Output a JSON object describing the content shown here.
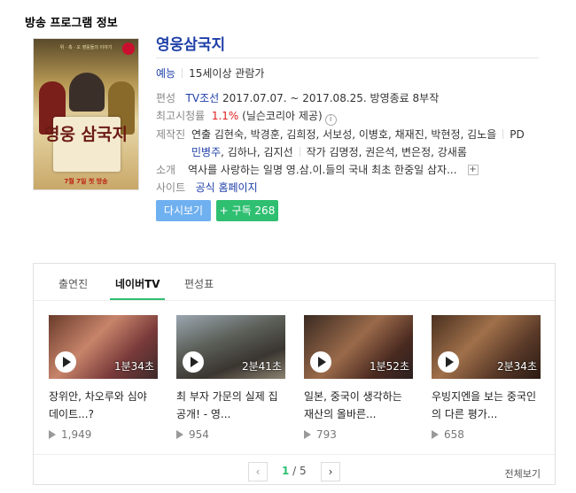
{
  "section_title": "방송 프로그램 정보",
  "poster": {
    "title": "영웅 삼국지",
    "tagline": "7월 7일 첫 방송",
    "top_text": "위 · 촉 · 오 영웅들의 이야기"
  },
  "program": {
    "title": "영웅삼국지",
    "genre": "예능",
    "rating": "15세이상 관람가",
    "schedule_label": "편성",
    "channel": "TV조선",
    "period": "2017.07.07. ~ 2017.08.25. 방영종료 8부작",
    "ratings_label": "최고시청률",
    "peak_rating": "1.1%",
    "rating_source": "(닐슨코리아 제공)",
    "info_icon": "i",
    "production_label": "제작진",
    "production_text_1": "연출 김현숙, 박경훈, 김희정, 서보성, 이병호, 채재진, 박현정, 김노을",
    "production_pd_prefix": "PD ",
    "production_pd_name": "민병주",
    "production_pd_rest": ", 김하나, 김지선",
    "production_writers": "작가 김명정, 권은석, 변은정, 강새롬",
    "desc_label": "소개",
    "description": "역사를 사랑하는 일명 영.삼.이.들의 국내 최초 한중일 삼자...",
    "site_label": "사이트",
    "site_link": "공식 홈페이지",
    "replay_button": "다시보기",
    "subscribe_button": "+ 구독 268"
  },
  "tabs": [
    "출연진",
    "네이버TV",
    "편성표"
  ],
  "active_tab": "네이버TV",
  "videos": [
    {
      "title": "장위안, 차오루와 심야 데이트...?",
      "duration": "1분34초",
      "views": "1,949"
    },
    {
      "title": "최 부자 가문의 실제 집 공개! - 영...",
      "duration": "2분41초",
      "views": "954"
    },
    {
      "title": "일본, 중국이 생각하는 재산의 올바른...",
      "duration": "1분52초",
      "views": "793"
    },
    {
      "title": "우빙지엔을 보는 중국인의 다른 평가...",
      "duration": "2분34초",
      "views": "658"
    }
  ],
  "pagination": {
    "current": "1",
    "separator": " / ",
    "total": "5",
    "prev": "‹",
    "next": "›"
  },
  "more_link": "전체보기",
  "colors": {
    "title_blue": "#1e3fa8",
    "accent_green": "#2fbf71",
    "replay_blue": "#6fb0f0",
    "rating_red": "#e02020"
  }
}
